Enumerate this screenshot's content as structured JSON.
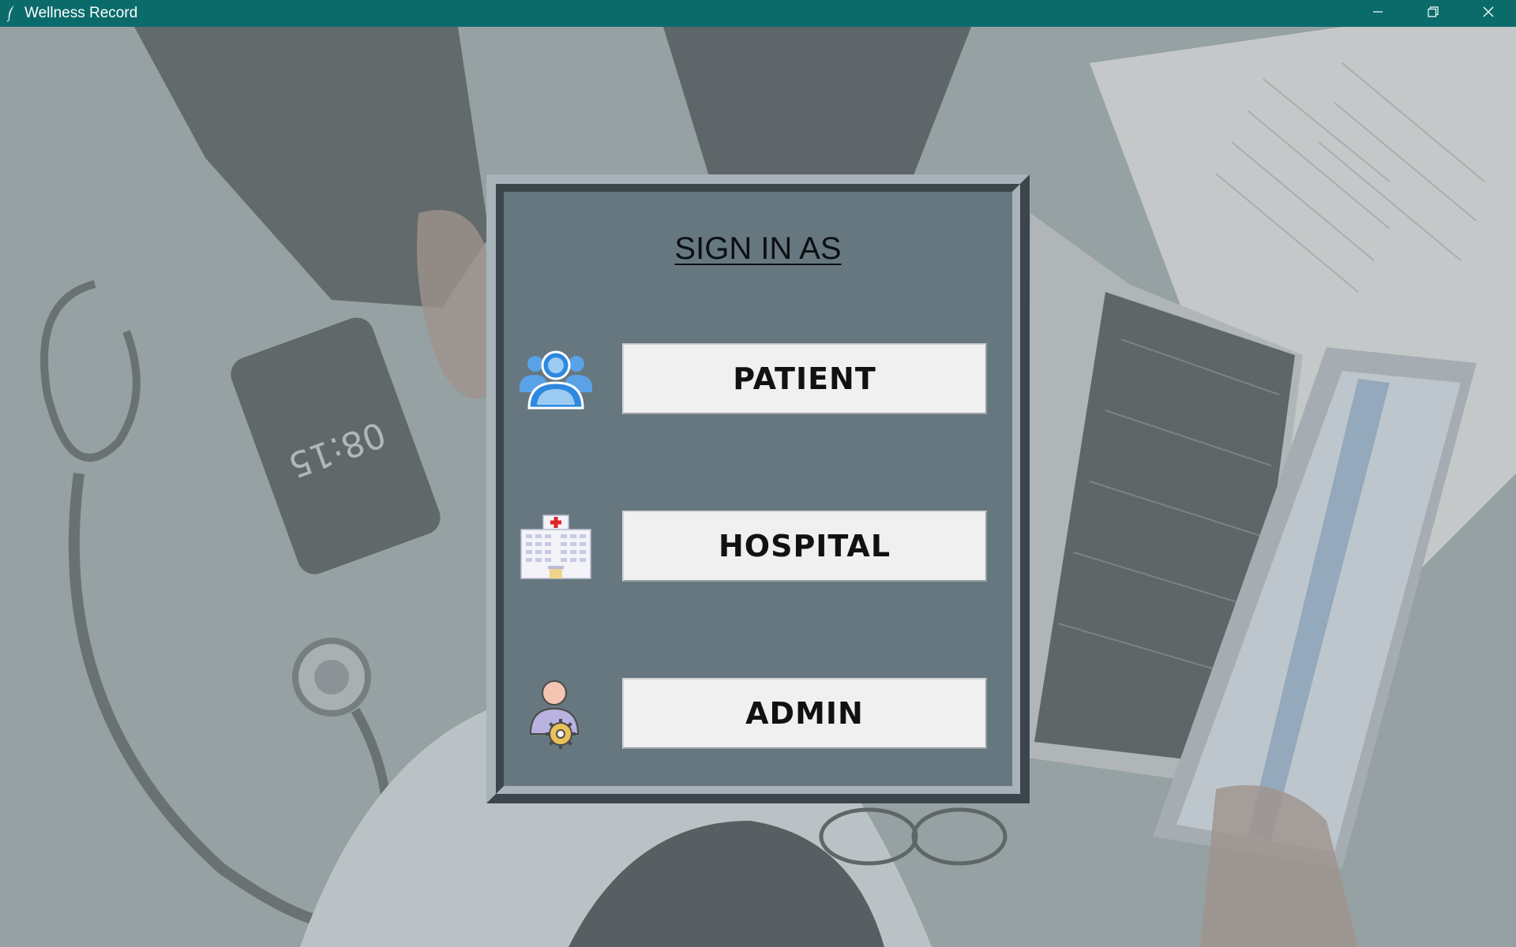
{
  "window": {
    "title": "Wellness Record",
    "controls": {
      "minimize": "minimize-icon",
      "restore": "restore-icon",
      "close": "close-icon"
    }
  },
  "colors": {
    "titlebar": "#0b6b6b",
    "panel": "#66777f",
    "button": "#f0f0f0"
  },
  "background": {
    "phone_clock": "08:15"
  },
  "signin": {
    "title": "SIGN IN AS",
    "roles": [
      {
        "label": "PATIENT",
        "icon": "patient-group-icon"
      },
      {
        "label": "HOSPITAL",
        "icon": "hospital-building-icon"
      },
      {
        "label": "ADMIN",
        "icon": "admin-user-gear-icon"
      }
    ]
  }
}
